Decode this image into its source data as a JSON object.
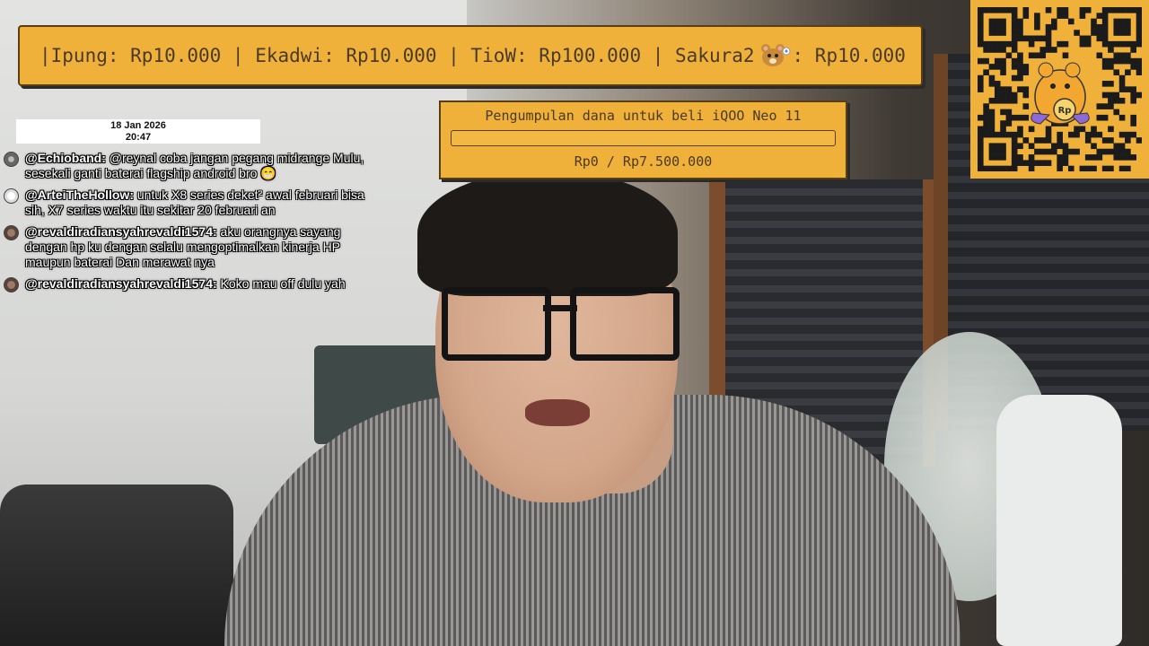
{
  "ticker": {
    "text_before_icon": "|Ipung: Rp10.000 | Ekadwi: Rp10.000 | TioW: Rp100.000 | Sakura2",
    "text_after_icon": ": Rp10.000",
    "icon": "hamster-emoji-icon"
  },
  "clock": {
    "date": "18 Jan 2026",
    "time": "20:47"
  },
  "chat": {
    "messages": [
      {
        "user": "@Echioband:",
        "text": " @reynal coba jangan pegang midrange Mulu, sesekali ganti baterai flagship android bro 😁",
        "avatar": "avatar-gray"
      },
      {
        "user": "@ArteiTheHollow:",
        "text": " untuk X8 series deket² awal februari bisa sih, X7 series waktu itu sekitar 20 februari an",
        "avatar": "avatar-white"
      },
      {
        "user": "@revaldiradiansyahrevaldi1574:",
        "text": " aku orangnya sayang dengan hp ku dengan selalu mengoptimalkan kinerja HP maupun baterai Dan merawat nya",
        "avatar": "avatar-photo"
      },
      {
        "user": "@revaldiradiansyahrevaldi1574:",
        "text": " Koko mau off dulu yah",
        "avatar": "avatar-photo"
      }
    ]
  },
  "goal": {
    "title": "Pengumpulan dana untuk beli iQOO Neo 11",
    "amount": "Rp0 / Rp7.500.000",
    "progress": 0
  },
  "qr": {
    "center_label": "Rp",
    "icon": "hamster-mascot-icon"
  },
  "colors": {
    "overlay_bg": "#f0b13b",
    "overlay_text": "#4a3a22"
  }
}
